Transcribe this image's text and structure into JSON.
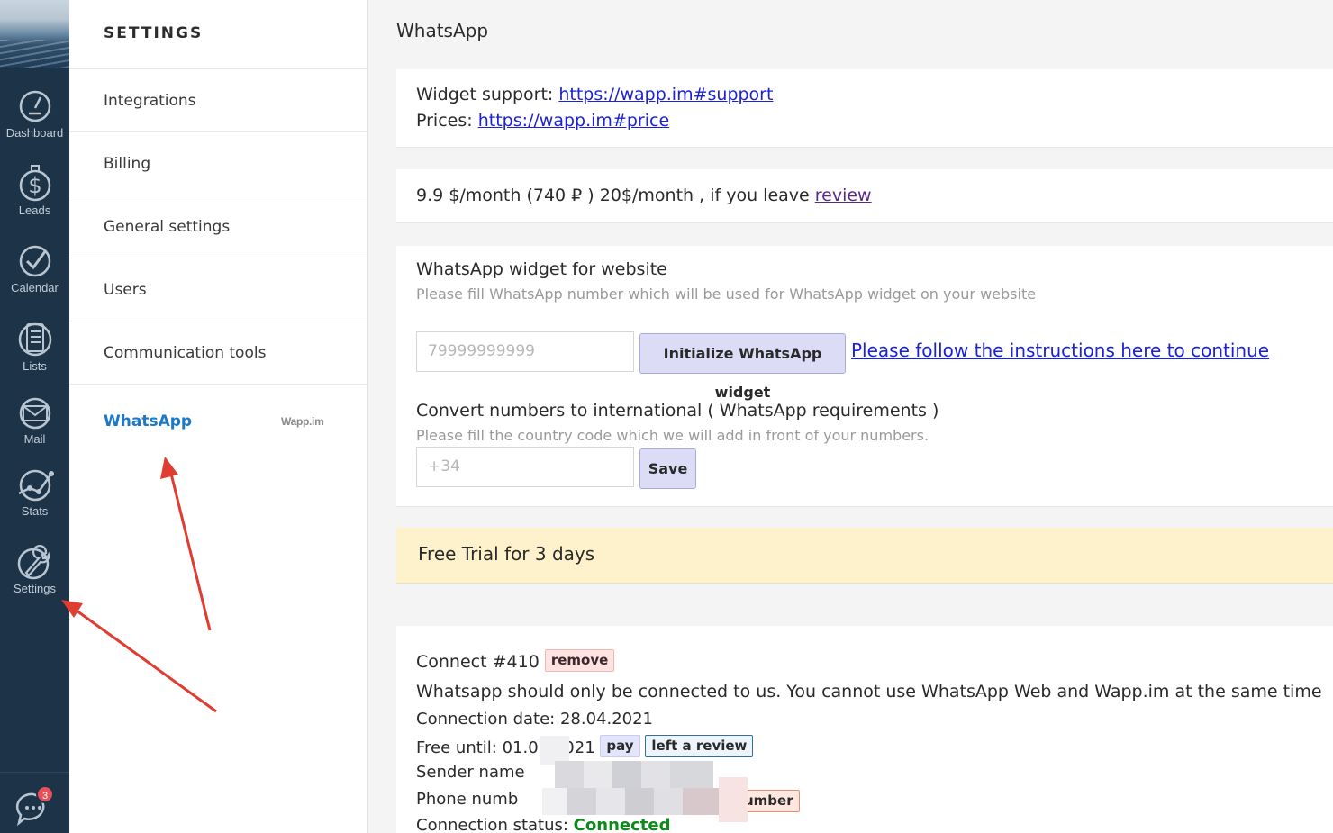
{
  "rail": {
    "items": [
      {
        "label": "Dashboard",
        "icon": "dashboard-icon"
      },
      {
        "label": "Leads",
        "icon": "dollar-icon"
      },
      {
        "label": "Calendar",
        "icon": "check-circle-icon"
      },
      {
        "label": "Lists",
        "icon": "list-icon"
      },
      {
        "label": "Mail",
        "icon": "mail-icon"
      },
      {
        "label": "Stats",
        "icon": "stats-icon"
      },
      {
        "label": "Settings",
        "icon": "wrench-icon"
      }
    ],
    "chat_badge": "3"
  },
  "settings_nav": {
    "title": "SETTINGS",
    "items": [
      {
        "label": "Integrations"
      },
      {
        "label": "Billing"
      },
      {
        "label": "General settings"
      },
      {
        "label": "Users"
      },
      {
        "label": "Communication tools"
      }
    ],
    "active": {
      "label": "WhatsApp",
      "brand": "Wapp.im"
    }
  },
  "main": {
    "title": "WhatsApp",
    "support": {
      "widget_label": "Widget support: ",
      "widget_link": "https://wapp.im#support",
      "prices_label": "Prices: ",
      "prices_link": "https://wapp.im#price"
    },
    "pricing": {
      "price": "9.9 $/month (740 ₽ ) ",
      "old_price": "20$/month",
      "suffix": " , if you leave ",
      "review_link": "review"
    },
    "widget": {
      "title": "WhatsApp widget for website",
      "description": "Please fill WhatsApp number which will be used for WhatsApp widget on your website",
      "phone_placeholder": "79999999999",
      "init_button": "Initialize WhatsApp widget",
      "instructions_link": "Please follow the instructions here to continue",
      "convert_title": "Convert numbers to international ( WhatsApp requirements )",
      "convert_description": "Please fill the country code which we will add in front of your numbers.",
      "code_placeholder": "+34",
      "save_button": "Save"
    },
    "trial": "Free Trial for 3 days",
    "connection": {
      "title": "Connect #410",
      "remove": "remove",
      "warning": "Whatsapp should only be connected to us. You cannot use WhatsApp Web and Wapp.im at the same time",
      "date_label": "Connection date: 28.04.2021",
      "free_until": "Free until: 01.05.2021",
      "pay": "pay",
      "review": "left a review",
      "sender_label": "Sender name",
      "phone_label": "Phone numb",
      "number_tag": "umber",
      "status_label": "Connection status: ",
      "status_value": "Connected"
    }
  }
}
